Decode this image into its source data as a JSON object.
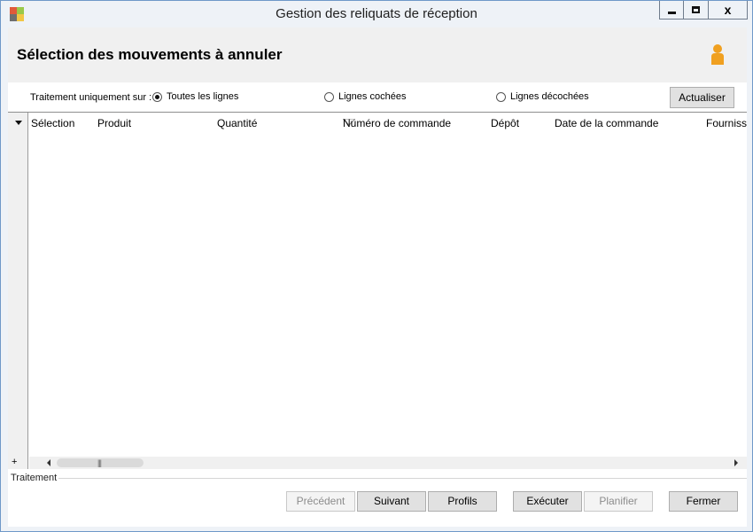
{
  "window": {
    "title": "Gestion des reliquats de réception",
    "close_glyph": "x",
    "app_icon_colors": [
      "#e05a3a",
      "#9ac94a",
      "#f2c744",
      "#6f6f6f"
    ]
  },
  "header": {
    "title": "Sélection des mouvements à annuler",
    "user_icon": "person-icon",
    "user_icon_color": "#f0a020"
  },
  "filter": {
    "label": "Traitement uniquement sur :",
    "options": [
      {
        "label": "Toutes les lignes",
        "checked": true
      },
      {
        "label": "Lignes cochées",
        "checked": false
      },
      {
        "label": "Lignes décochées",
        "checked": false
      }
    ],
    "refresh_button": "Actualiser"
  },
  "grid": {
    "columns": [
      "Sélection",
      "Produit",
      "Quantité",
      "Numéro de commande",
      "Dépôt",
      "Date de la commande",
      "Fourniss"
    ],
    "rows": [],
    "add_row": "+",
    "scroll_grip": "|||"
  },
  "footer": {
    "group_label": "Traitement",
    "buttons": {
      "previous": "Précédent",
      "next": "Suivant",
      "profiles": "Profils",
      "execute": "Exécuter",
      "schedule": "Planifier",
      "close": "Fermer"
    }
  }
}
